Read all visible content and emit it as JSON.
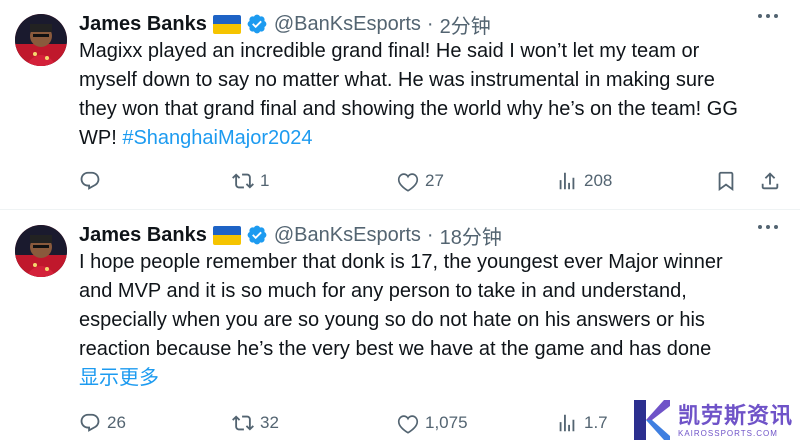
{
  "tweets": [
    {
      "author": "James Banks",
      "handle": "@BanKsEsports",
      "separator": "·",
      "time": "2分钟",
      "text_lines": [
        "Magixx played an incredible grand final! He said I won’t let my team or",
        "myself down to say no matter what. He was instrumental in making sure",
        "they won that grand final and showing the world why he’s on the team! GG"
      ],
      "last_line_text": "WP! ",
      "hashtag": "#ShanghaiMajor2024",
      "replies": "",
      "retweets": "1",
      "likes": "27",
      "views": "208"
    },
    {
      "author": "James Banks",
      "handle": "@BanKsEsports",
      "separator": "·",
      "time": "18分钟",
      "text_lines": [
        "I hope people remember that donk is 17, the youngest ever Major winner",
        "and MVP and it is so much for any person to take in and understand,",
        "especially when you are so young so do not hate on his answers or his",
        "reaction because he’s the very best we have at the game and has done"
      ],
      "show_more": "显示更多",
      "replies": "26",
      "retweets": "32",
      "likes": "1,075",
      "views": "1.7"
    }
  ],
  "icons": {
    "verified": "verified-badge-icon",
    "flag": "ukraine-flag-icon",
    "reply": "reply-icon",
    "retweet": "retweet-icon",
    "like": "heart-icon",
    "views": "analytics-icon",
    "bookmark": "bookmark-icon",
    "share": "share-icon",
    "more": "more-icon"
  },
  "colors": {
    "text": "#0f1419",
    "muted": "#536471",
    "link": "#1d9bf0",
    "verified": "#1d9bf0",
    "divider": "#eff3f4"
  },
  "watermark": {
    "name": "凯劳斯资讯",
    "domain": "KAIROSSPORTS.COM"
  }
}
